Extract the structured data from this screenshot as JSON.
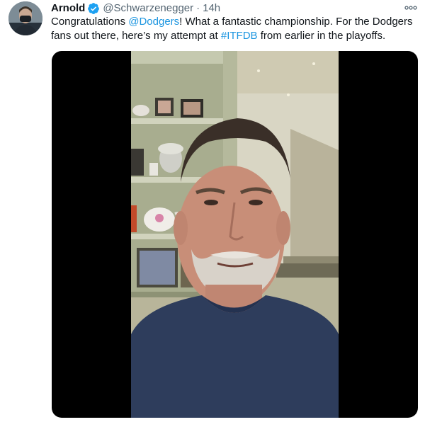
{
  "tweet": {
    "author_name": "Arnold",
    "verified_icon": "verified-badge-icon",
    "handle": "@Schwarzenegger",
    "separator": "·",
    "time": "14h",
    "more_icon": "more-options-icon",
    "text_parts": {
      "p1": "Congratulations ",
      "mention": "@Dodgers",
      "p2": "! What a fantastic championship. For the Dodgers fans out there, here’s my attempt at ",
      "hashtag": "#ITFDB",
      "p3": " from earlier in the playoffs."
    },
    "media": {
      "type": "video"
    }
  },
  "colors": {
    "link": "#1b95e0",
    "verified": "#1da1f2",
    "secondary_text": "#536471"
  }
}
